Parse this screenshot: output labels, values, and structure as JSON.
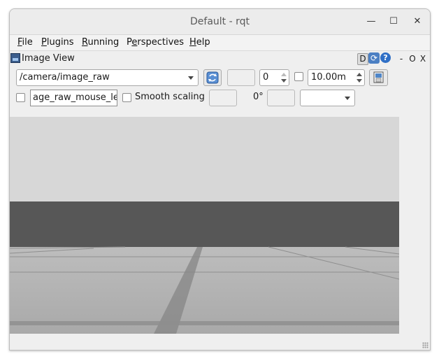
{
  "window": {
    "title": "Default - rqt",
    "minimize_glyph": "—",
    "maximize_glyph": "☐",
    "close_glyph": "✕"
  },
  "menubar": {
    "items": [
      {
        "label": "File",
        "mnemonic": "F",
        "rest": "ile"
      },
      {
        "label": "Plugins",
        "mnemonic": "P",
        "rest": "lugins"
      },
      {
        "label": "Running",
        "mnemonic": "R",
        "rest": "unning"
      },
      {
        "label": "Perspectives",
        "pre": "P",
        "mnemonic": "e",
        "rest": "rspectives"
      },
      {
        "label": "Help",
        "mnemonic": "H",
        "rest": "elp"
      }
    ]
  },
  "dock": {
    "title": "Image View",
    "d_label": "D",
    "help_label": "?",
    "minimize_label": "-",
    "float_label": "O",
    "close_label": "X",
    "icons": [
      "image-view-icon",
      "refresh-icon",
      "help-icon"
    ]
  },
  "toolbar": {
    "topic_value": "/camera/image_raw",
    "spin_value": "0",
    "max_range_value": "10.00m",
    "mouse_topic_value": "age_raw_mouse_left",
    "smooth_scaling_label": "Smooth scaling",
    "rotation_label": "0°",
    "smooth_scaling_checked": false
  },
  "viewport": {
    "sky_color": "#d7d7d7",
    "wall_color": "#575757",
    "floor_color": "#b4b4b4"
  }
}
